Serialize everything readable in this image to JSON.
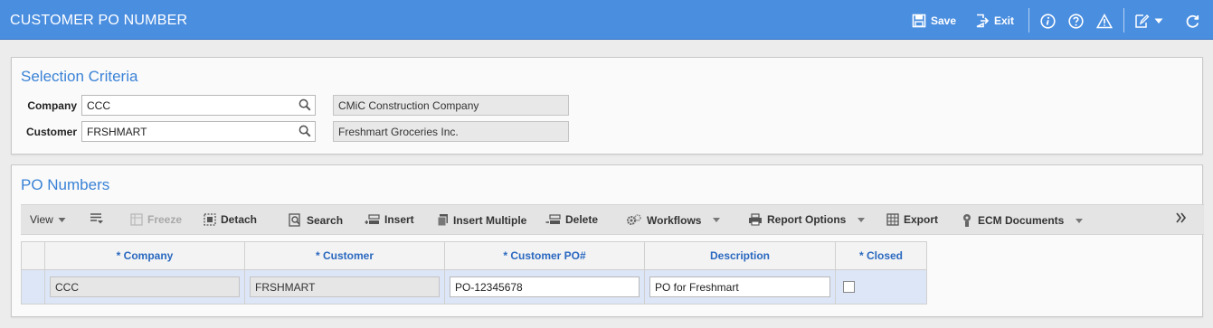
{
  "header": {
    "title": "CUSTOMER PO NUMBER",
    "save_label": "Save",
    "exit_label": "Exit"
  },
  "selection": {
    "title": "Selection Criteria",
    "company_label": "Company",
    "company_value": "CCC",
    "company_name": "CMiC Construction Company",
    "customer_label": "Customer",
    "customer_value": "FRSHMART",
    "customer_name": "Freshmart Groceries Inc."
  },
  "po_panel": {
    "title": "PO Numbers"
  },
  "toolbar": {
    "view": "View",
    "freeze": "Freeze",
    "detach": "Detach",
    "search": "Search",
    "insert": "Insert",
    "insert_multiple": "Insert Multiple",
    "delete": "Delete",
    "workflows": "Workflows",
    "report_options": "Report Options",
    "export": "Export",
    "ecm_documents": "ECM Documents"
  },
  "grid": {
    "columns": [
      "* Company",
      "* Customer",
      "* Customer PO#",
      "Description",
      "* Closed"
    ],
    "rows": [
      {
        "company": "CCC",
        "customer": "FRSHMART",
        "po": "PO-12345678",
        "description": "PO for Freshmart",
        "closed": false
      }
    ]
  },
  "colors": {
    "header_bg": "#4a8ee0",
    "accent_blue": "#3a82d6",
    "row_selected": "#dde6f7"
  }
}
